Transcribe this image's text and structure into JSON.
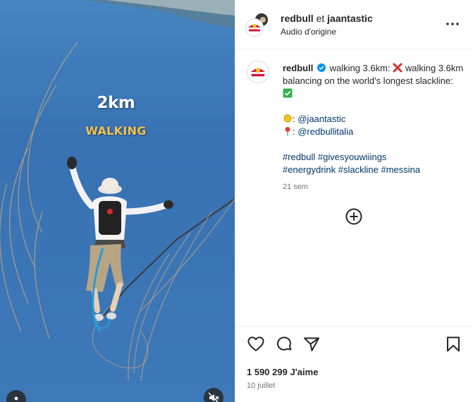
{
  "media": {
    "overlay_distance": "2km",
    "overlay_activity": "WALKING"
  },
  "header": {
    "user1": "redbull",
    "connector": "et",
    "user2": "jaantastic",
    "audio": "Audio d'origine"
  },
  "caption": {
    "username": "redbull",
    "line1": "walking 3.6km:",
    "line2": "walking 3.6km balancing on the world's longest slackline:",
    "credit1_mention": "@jaantastic",
    "credit2_mention": "@redbullitalia",
    "hashtags_line1": "#redbull #givesyouwiiings",
    "hashtags_line2": "#energydrink #slackline #messina",
    "time_ago": "21 sem"
  },
  "footer": {
    "likes_count": "1 590 299",
    "likes_label": "J'aime",
    "date": "10 juillet"
  },
  "icons": {
    "verified": "verified-badge-icon",
    "more": "more-options-icon",
    "add_comment": "plus-circle-icon",
    "like": "heart-icon",
    "comment": "comment-icon",
    "share": "share-icon",
    "save": "bookmark-icon",
    "mute": "muted-speaker-icon"
  },
  "colors": {
    "verified_blue": "#0095f6",
    "hashtag": "#00376b",
    "overlay_yellow": "#f2c14e",
    "cross_red": "#d0342c",
    "check_green": "#33b249"
  }
}
